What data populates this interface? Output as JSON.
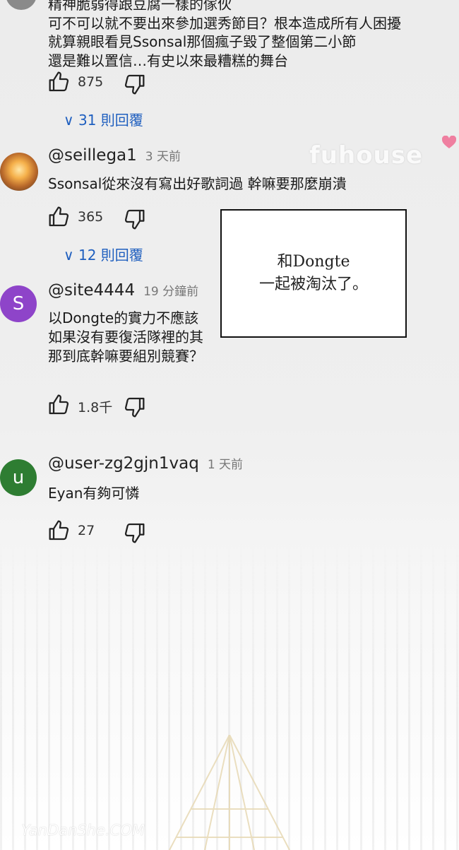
{
  "thread": {
    "top_comment": {
      "lines": [
        "精神脆弱得跟豆腐一樣的傢伙",
        "可不可以就不要出來參加選秀節目？根本造成所有人困擾",
        "就算親眼看見Ssonsal那個瘋子毀了整個第二小節",
        "還是難以置信…有史以來最糟糕的舞台"
      ],
      "likes": "875",
      "replies": "31 則回覆"
    },
    "comments": [
      {
        "handle": "@seillega1",
        "time": "3 天前",
        "text": "Ssonsal從來沒有寫出好歌詞過 幹嘛要那麼崩潰",
        "likes": "365",
        "replies": "12 則回覆"
      },
      {
        "handle": "@site4444",
        "time": "19 分鐘前",
        "avatar_letter": "S",
        "avatar_color": "#8e44c9",
        "lines": [
          "以Dongte的實力不應該",
          "如果沒有要復活隊裡的其",
          "那到底幹嘛要組別競賽？"
        ],
        "likes": "1.8千"
      },
      {
        "handle": "@user-zg2gjn1vaq",
        "time": "1 天前",
        "avatar_letter": "u",
        "avatar_color": "#2e7d32",
        "text": "Eyan有夠可憐",
        "likes": "27"
      }
    ]
  },
  "caption_box": {
    "line1": "和Dongte",
    "line2": "一起被淘汰了。"
  },
  "watermarks": {
    "top": "fuhouse",
    "bottom": "YanDanShe.COM"
  },
  "colors": {
    "reply_link": "#1f5fbf",
    "heart": "#ef7fa0"
  }
}
